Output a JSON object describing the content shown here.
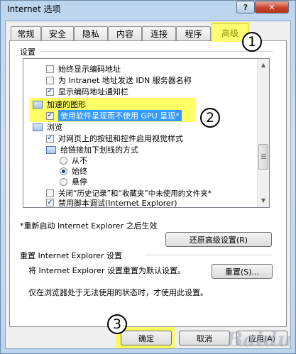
{
  "window": {
    "title": "Internet 选项",
    "help_glyph": "?",
    "close_glyph": "✕"
  },
  "tabs": [
    {
      "label": "常规"
    },
    {
      "label": "安全"
    },
    {
      "label": "隐私"
    },
    {
      "label": "内容"
    },
    {
      "label": "连接"
    },
    {
      "label": "程序"
    },
    {
      "label": "高级",
      "active": true
    }
  ],
  "settings": {
    "group_label": "设置",
    "items": [
      {
        "type": "checkbox",
        "checked": false,
        "label": "始终显示编码地址"
      },
      {
        "type": "checkbox",
        "checked": false,
        "label": "为 Intranet 地址发送 IDN 服务器名称"
      },
      {
        "type": "checkbox",
        "checked": true,
        "label": "显示编码地址通知栏"
      },
      {
        "type": "folder",
        "label": "加速的图形"
      },
      {
        "type": "checkbox",
        "checked": true,
        "label": "使用软件呈现而不使用 GPU 呈现*",
        "selected": true
      },
      {
        "type": "folder",
        "label": "浏览"
      },
      {
        "type": "checkbox",
        "checked": true,
        "label": "对网页上的按钮和控件启用视觉样式"
      },
      {
        "type": "folder",
        "label": "给链接加下划线的方式"
      },
      {
        "type": "radio",
        "checked": false,
        "label": "从不"
      },
      {
        "type": "radio",
        "checked": true,
        "label": "始终"
      },
      {
        "type": "radio",
        "checked": false,
        "label": "悬停"
      },
      {
        "type": "checkbox",
        "checked": false,
        "label": "关闭“历史记录”和“收藏夹”中未使用的文件夹*"
      },
      {
        "type": "checkbox",
        "checked": true,
        "label": "禁用脚本调试(Internet Explorer)"
      }
    ]
  },
  "restart_note": "*重新启动 Internet Explorer 之后生效",
  "restore_button": "还原高级设置(R)",
  "reset": {
    "heading": "重置 Internet Explorer 设置",
    "description": "将 Internet Explorer 设置重置为默认设置。",
    "button": "重置(S)...",
    "note": "仅在浏览器处于无法使用的状态时，才使用此设置。"
  },
  "footer": {
    "ok": "确定",
    "cancel": "取消",
    "apply": "应用(A)"
  },
  "annotations": {
    "one": "1",
    "two": "2",
    "three": "3"
  },
  "watermark": "Baidu"
}
